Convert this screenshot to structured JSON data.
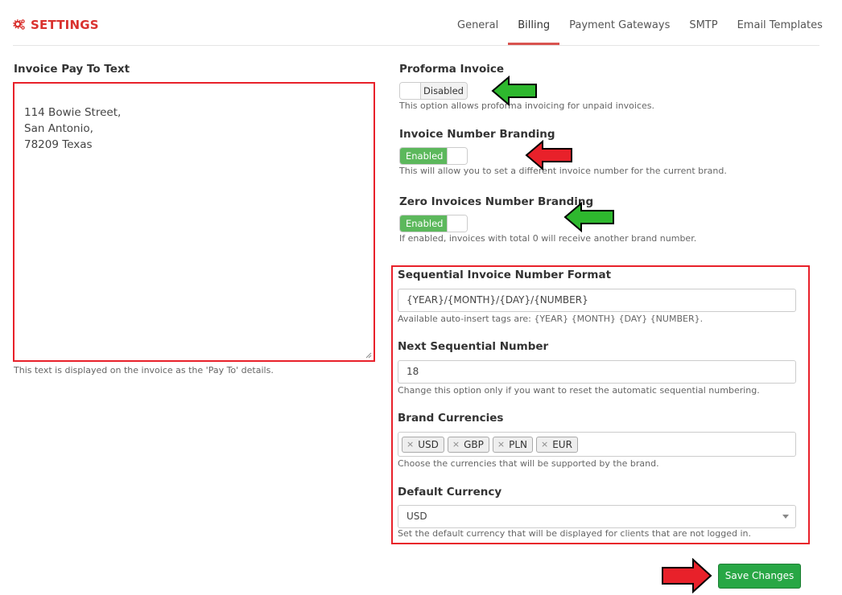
{
  "header": {
    "title": "SETTINGS",
    "tabs": [
      {
        "label": "General",
        "active": false
      },
      {
        "label": "Billing",
        "active": true
      },
      {
        "label": "Payment Gateways",
        "active": false
      },
      {
        "label": "SMTP",
        "active": false
      },
      {
        "label": "Email Templates",
        "active": false
      }
    ]
  },
  "invoice_pay_to": {
    "label": "Invoice Pay To Text",
    "value": "114 Bowie Street,\nSan Antonio,\n78209 Texas",
    "help": "This text is displayed on the invoice as the 'Pay To' details."
  },
  "proforma": {
    "label": "Proforma Invoice",
    "toggle_text": "Disabled",
    "help": "This option allows proforma invoicing for unpaid invoices."
  },
  "number_branding": {
    "label": "Invoice Number Branding",
    "toggle_text": "Enabled",
    "help": "This will allow you to set a different invoice number for the current brand."
  },
  "zero_branding": {
    "label": "Zero Invoices Number Branding",
    "toggle_text": "Enabled",
    "help": "If enabled, invoices with total 0 will receive another brand number."
  },
  "sequential_format": {
    "label": "Sequential Invoice Number Format",
    "value": "{YEAR}/{MONTH}/{DAY}/{NUMBER}",
    "help": "Available auto-insert tags are: {YEAR} {MONTH} {DAY} {NUMBER}."
  },
  "next_number": {
    "label": "Next Sequential Number",
    "value": "18",
    "help": "Change this option only if you want to reset the automatic sequential numbering."
  },
  "brand_currencies": {
    "label": "Brand Currencies",
    "tags": [
      "USD",
      "GBP",
      "PLN",
      "EUR"
    ],
    "help": "Choose the currencies that will be supported by the brand."
  },
  "default_currency": {
    "label": "Default Currency",
    "value": "USD",
    "help": "Set the default currency that will be displayed for clients that are not logged in."
  },
  "actions": {
    "save_label": "Save Changes"
  },
  "colors": {
    "accent": "#d9312e",
    "highlight_box": "#e8212a",
    "toggle_on": "#5cb85c",
    "save_button": "#28a745",
    "arrow_green": "#2eb82e",
    "arrow_red": "#e8212a"
  },
  "icons": {
    "title_icon": "cogs-icon",
    "arrow": "left-arrow-icon"
  }
}
